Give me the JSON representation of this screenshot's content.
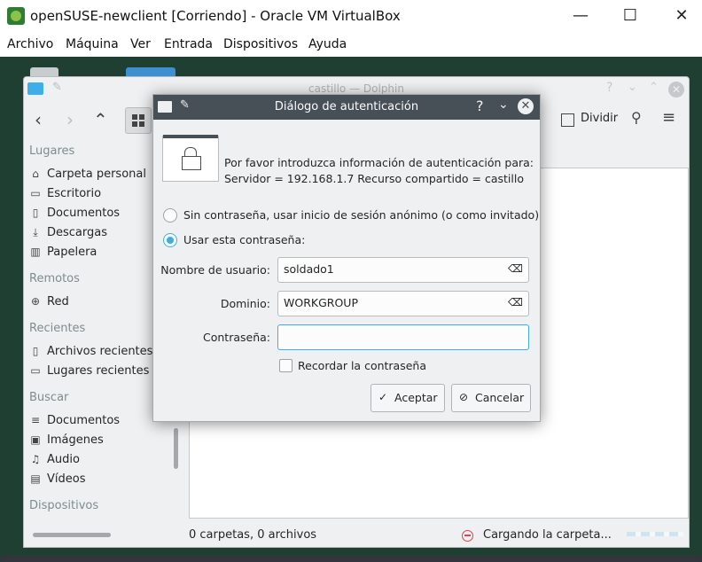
{
  "vbox": {
    "title": "openSUSE-newclient [Corriendo] - Oracle VM VirtualBox",
    "menu": [
      "Archivo",
      "Máquina",
      "Ver",
      "Entrada",
      "Dispositivos",
      "Ayuda"
    ],
    "controls": {
      "minimize": "—",
      "maximize": "☐",
      "close": "✕"
    }
  },
  "dolphin": {
    "title": "castillo — Dolphin",
    "toolbar": {
      "split_label": "Dividir"
    },
    "places": {
      "lugares": {
        "heading": "Lugares",
        "items": [
          "Carpeta personal",
          "Escritorio",
          "Documentos",
          "Descargas",
          "Papelera"
        ]
      },
      "remotos": {
        "heading": "Remotos",
        "items": [
          "Red"
        ]
      },
      "recientes": {
        "heading": "Recientes",
        "items": [
          "Archivos recientes",
          "Lugares recientes"
        ]
      },
      "buscar": {
        "heading": "Buscar",
        "items": [
          "Documentos",
          "Imágenes",
          "Audio",
          "Vídeos"
        ]
      },
      "dispositivos": {
        "heading": "Dispositivos"
      }
    },
    "status": {
      "left": "0 carpetas, 0 archivos",
      "right": "Cargando la carpeta..."
    }
  },
  "dialog": {
    "title": "Diálogo de autenticación",
    "prompt_line1": "Por favor introduzca información de autenticación para:",
    "prompt_line2": "Servidor = 192.168.1.7 Recurso compartido = castillo",
    "radio_anonymous": "Sin contraseña, usar inicio de sesión anónimo (o como invitado)",
    "radio_password": "Usar esta contraseña:",
    "username_label": "Nombre de usuario:",
    "username_value": "soldado1",
    "domain_label": "Dominio:",
    "domain_value": "WORKGROUP",
    "password_label": "Contraseña:",
    "password_value": "",
    "remember_label": "Recordar la contraseña",
    "ok_label": "Aceptar",
    "cancel_label": "Cancelar"
  }
}
